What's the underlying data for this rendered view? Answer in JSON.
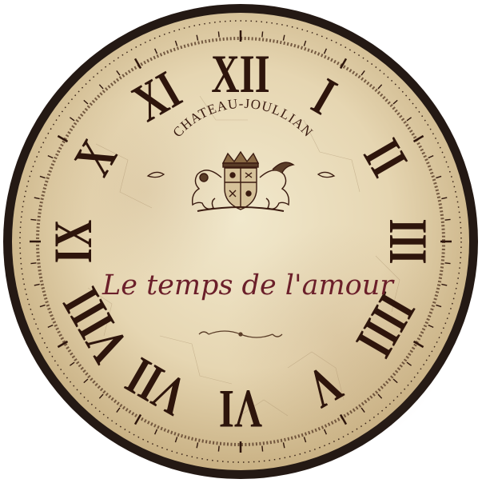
{
  "clock_face": {
    "brand": "CHATEAU-JOULLIAN",
    "motto": "Le temps de l'amour",
    "numerals": [
      "XII",
      "I",
      "II",
      "III",
      "IIII",
      "V",
      "VI",
      "VII",
      "VIII",
      "IX",
      "X",
      "XI"
    ],
    "emblem_icon": "heraldic-crest-icon",
    "flourish_icon": "ornamental-flourish-icon",
    "colors": {
      "face": "#e9dcbc",
      "face_edge": "#cdb98d",
      "rim": "#241914",
      "ink": "#2e150c",
      "motto": "#6b1f2a"
    }
  }
}
